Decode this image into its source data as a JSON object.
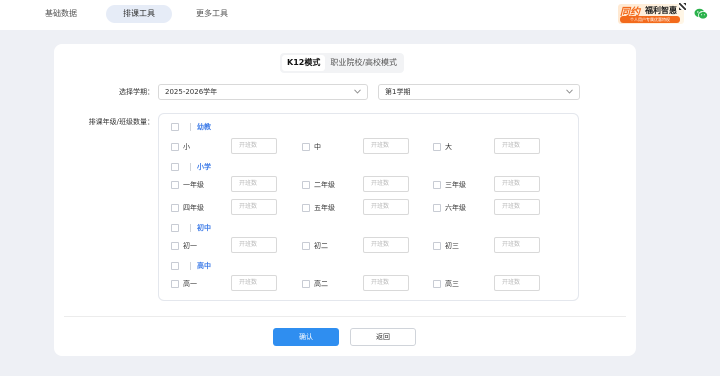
{
  "nav": {
    "tabs": [
      "基础数据",
      "排课工具",
      "更多工具"
    ],
    "active": 1
  },
  "promo": {
    "brand": "同约",
    "title": "福利智惠",
    "subtitle": "个人用户专属优惠特权"
  },
  "mode_tabs": [
    "K12模式",
    "职业院校/高校模式"
  ],
  "form": {
    "term_label": "选择学期：",
    "year_value": "2025-2026学年",
    "semester_value": "第1学期",
    "grades_label": "排课年级/班级数量："
  },
  "count_placeholder": "开班数",
  "groups": {
    "kinder": {
      "title": "幼教",
      "items": [
        "小",
        "中",
        "大"
      ]
    },
    "primary": {
      "title": "小学",
      "row1": [
        "一年级",
        "二年级",
        "三年级"
      ],
      "row2": [
        "四年级",
        "五年级",
        "六年级"
      ]
    },
    "junior": {
      "title": "初中",
      "items": [
        "初一",
        "初二",
        "初三"
      ]
    },
    "senior": {
      "title": "高中",
      "items": [
        "高一",
        "高二",
        "高三"
      ]
    }
  },
  "buttons": {
    "confirm": "确认",
    "back": "返回"
  },
  "colors": {
    "accent": "#2f8ef0",
    "group_title": "#3d7be8",
    "promo": "#f36a1c"
  }
}
